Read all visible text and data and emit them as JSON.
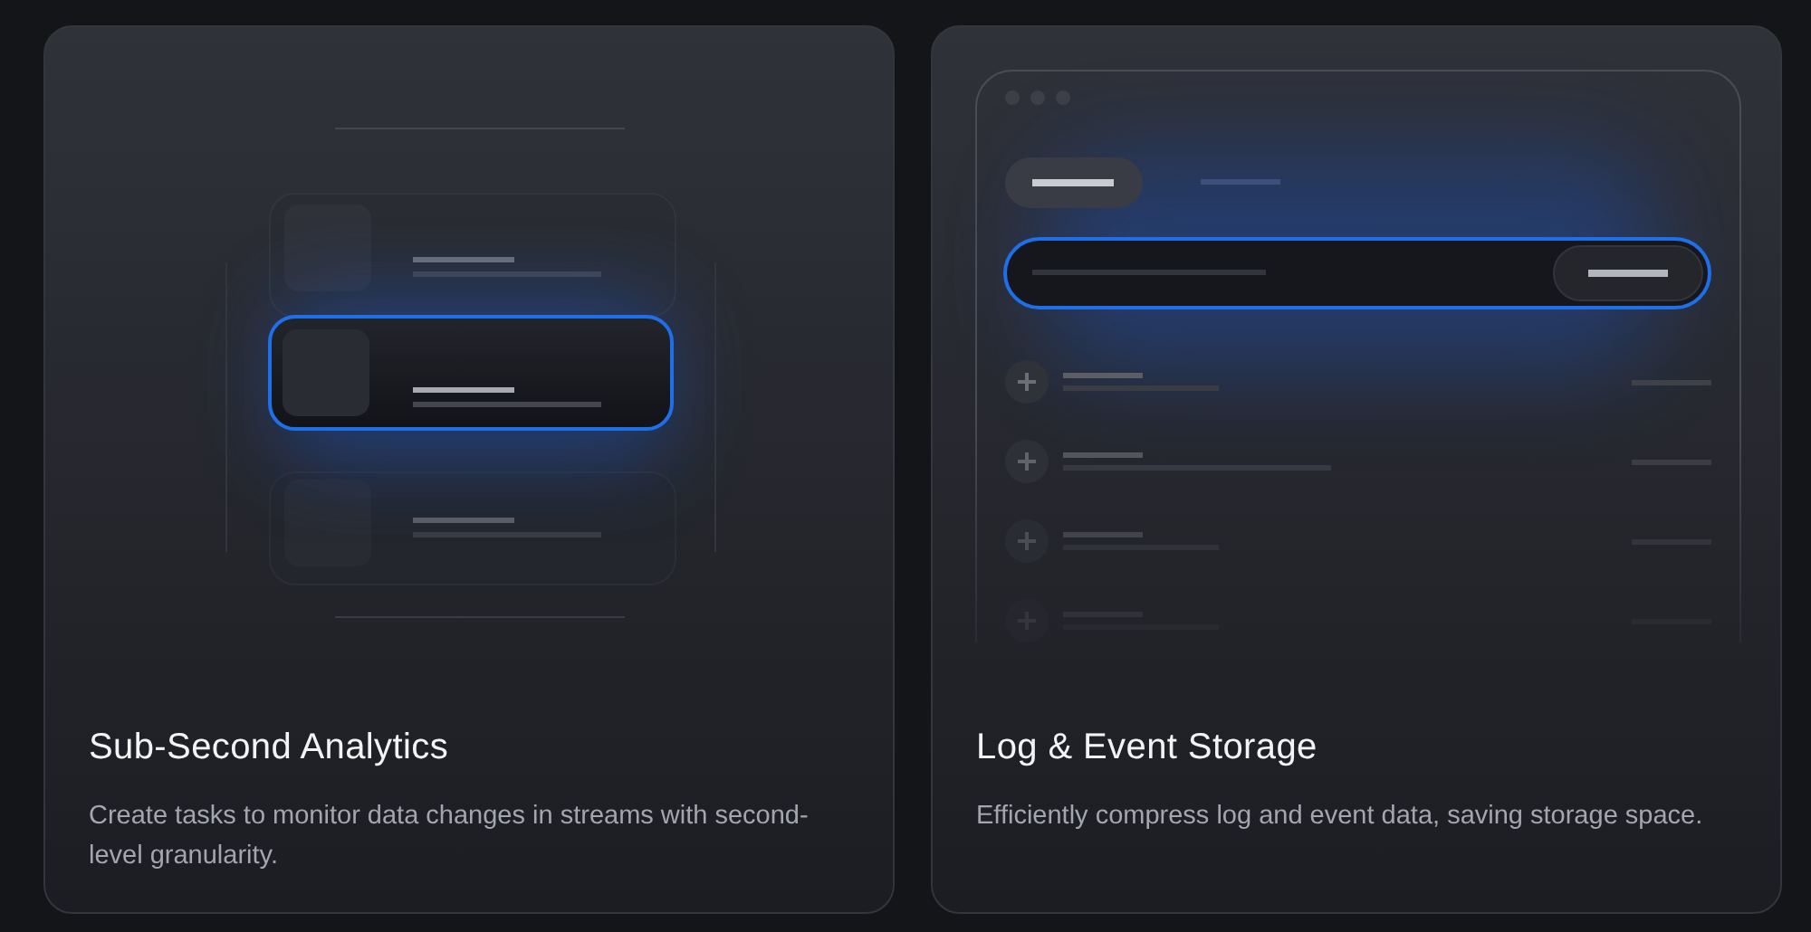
{
  "cards": [
    {
      "kind": "list",
      "title": "Sub-Second Analytics",
      "description": "Create tasks to monitor data changes in streams with second-level granularity."
    },
    {
      "kind": "window",
      "title": "Log & Event Storage",
      "description": "Efficiently compress log and event data, saving storage space."
    }
  ]
}
